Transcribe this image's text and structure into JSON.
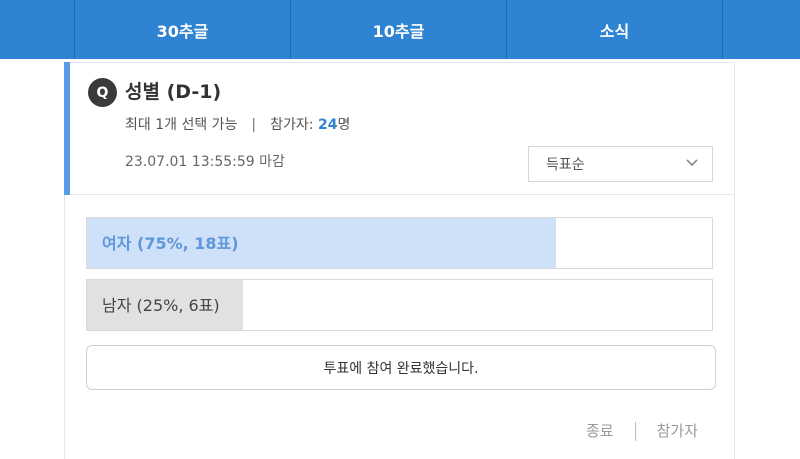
{
  "nav": {
    "tabs": [
      {
        "label": "30추글"
      },
      {
        "label": "10추글"
      },
      {
        "label": "소식"
      }
    ]
  },
  "poll": {
    "badge": "Q",
    "title": "성별 (D-1)",
    "max_select": "최대 1개 선택 가능",
    "separator": "|",
    "participants_label": "참가자: ",
    "participants_count": "24",
    "participants_unit": "명",
    "deadline": "23.07.01 13:55:59 마감",
    "sort": {
      "selected": "득표순"
    },
    "options": [
      {
        "label": "여자 (75%, 18표)",
        "fraction": 0.75
      },
      {
        "label": "남자 (25%, 6표)",
        "fraction": 0.25
      }
    ],
    "voted_message": "투표에 참여 완료했습니다.",
    "footer": {
      "close_label": "종료",
      "participants_label": "참가자"
    }
  },
  "colors": {
    "nav_bg": "#2f83d3",
    "accent": "#5a9ae6",
    "option_fill_leading": "#cfe1f8",
    "option_fill_other": "#e1e1e1"
  }
}
